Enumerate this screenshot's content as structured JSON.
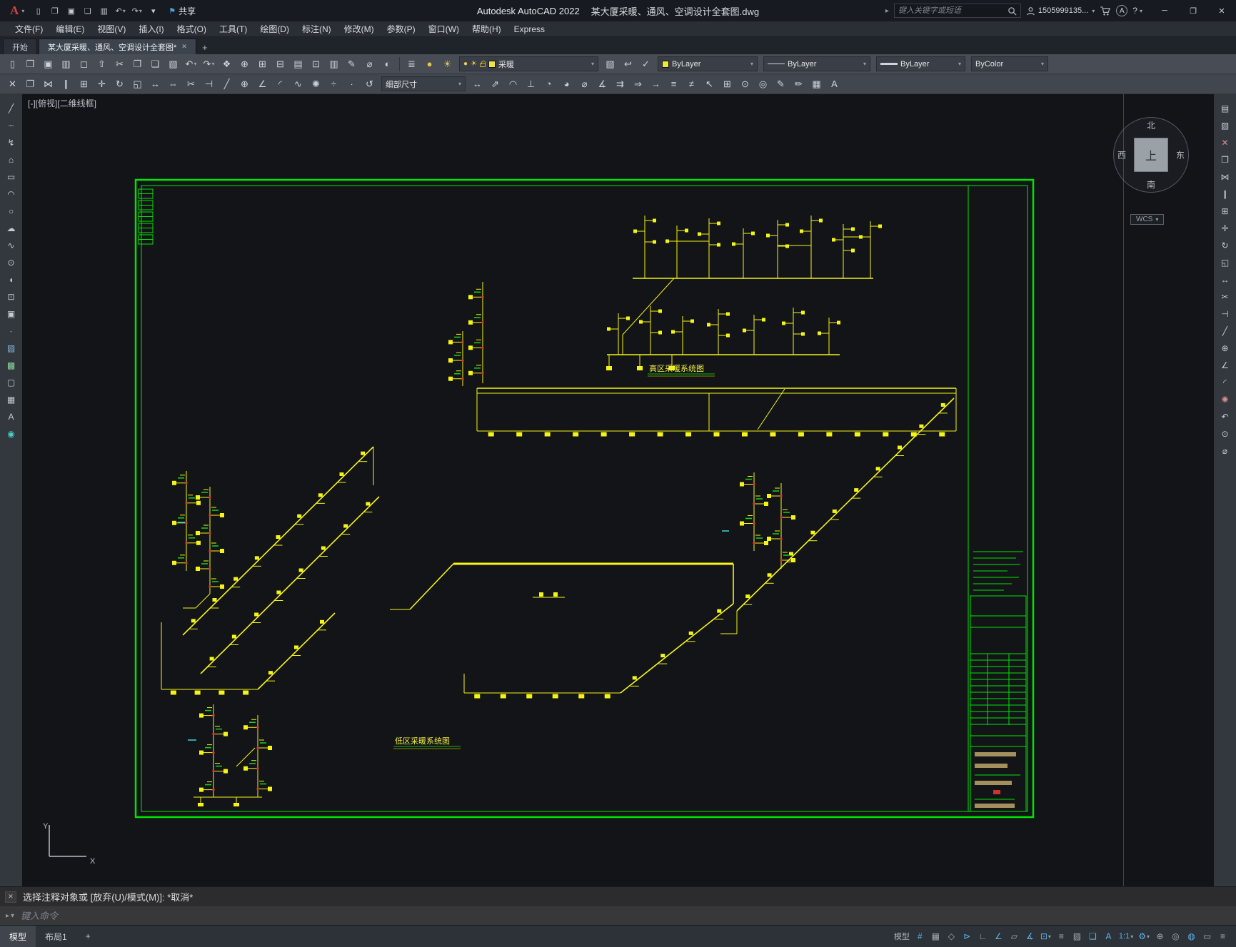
{
  "titlebar": {
    "logo_letter": "A",
    "app_title": "Autodesk AutoCAD 2022",
    "doc_title": "某大厦采暖、通风、空调设计全套图.dwg",
    "share_label": "共享",
    "search_placeholder": "键入关键字或短语",
    "user": "1505999135..."
  },
  "menu": {
    "items": [
      {
        "id": "file",
        "label": "文件(F)"
      },
      {
        "id": "edit",
        "label": "编辑(E)"
      },
      {
        "id": "view",
        "label": "视图(V)"
      },
      {
        "id": "insert",
        "label": "插入(I)"
      },
      {
        "id": "format",
        "label": "格式(O)"
      },
      {
        "id": "tools",
        "label": "工具(T)"
      },
      {
        "id": "draw",
        "label": "绘图(D)"
      },
      {
        "id": "dimension",
        "label": "标注(N)"
      },
      {
        "id": "modify",
        "label": "修改(M)"
      },
      {
        "id": "parametric",
        "label": "参数(P)"
      },
      {
        "id": "window",
        "label": "窗口(W)"
      },
      {
        "id": "help",
        "label": "帮助(H)"
      },
      {
        "id": "express",
        "label": "Express"
      }
    ]
  },
  "tabs": {
    "start": "开始",
    "drawing": "某大厦采暖、通风、空调设计全套图*"
  },
  "toolbar1": {
    "layer": "采暖",
    "color": "ByLayer",
    "linetype": "ByLayer",
    "lineweight": "ByLayer",
    "plotstyle": "ByColor"
  },
  "toolbar2": {
    "dim_style": "细部尺寸"
  },
  "canvas": {
    "viewport_label": "[-][俯视][二维线框]",
    "labels": {
      "high": "高区采暖系统图",
      "low": "低区采暖系统图"
    },
    "viewcube": {
      "n": "北",
      "s": "南",
      "w": "西",
      "e": "东",
      "top": "上",
      "wcs": "WCS"
    }
  },
  "command": {
    "history": "选择注释对象或 [放弃(U)/模式(M)]: *取消*",
    "placeholder": "键入命令"
  },
  "statusbar": {
    "model_tab": "模型",
    "layout_tab": "布局1",
    "new_layout": "+"
  },
  "colors": {
    "frame_green": "#00e400",
    "pipe_yellow": "#f4f416",
    "accent_blue": "#5fb2e8"
  },
  "icons": {
    "qa": [
      {
        "n": "new-drawing",
        "g": "▯"
      },
      {
        "n": "open-drawing",
        "g": "❒"
      },
      {
        "n": "save",
        "g": "▣"
      },
      {
        "n": "save-as",
        "g": "❏"
      },
      {
        "n": "plot",
        "g": "▥"
      },
      {
        "n": "undo",
        "g": "↶",
        "dd": 1
      },
      {
        "n": "redo",
        "g": "↷",
        "dd": 1
      },
      {
        "n": "customize-quick-access",
        "g": "▾"
      }
    ],
    "tb1": [
      {
        "n": "qnew",
        "g": "▯"
      },
      {
        "n": "open",
        "g": "❒"
      },
      {
        "n": "save-file",
        "g": "▣"
      },
      {
        "n": "plot-drawing",
        "g": "▥"
      },
      {
        "n": "plot-preview",
        "g": "◻"
      },
      {
        "n": "publish",
        "g": "⇧"
      },
      {
        "n": "cut-clip",
        "g": "✂"
      },
      {
        "n": "copy-clip",
        "g": "❐"
      },
      {
        "n": "paste-clip",
        "g": "❑"
      },
      {
        "n": "match-properties",
        "g": "▧"
      },
      {
        "n": "undo-action",
        "g": "↶",
        "dd": 1
      },
      {
        "n": "redo-action",
        "g": "↷",
        "dd": 1
      },
      {
        "n": "pan-realtime",
        "g": "❖"
      },
      {
        "n": "zoom-realtime",
        "g": "⊕"
      },
      {
        "n": "zoom-window",
        "g": "⊞"
      },
      {
        "n": "zoom-previous",
        "g": "⊟"
      },
      {
        "n": "properties-palette",
        "g": "▤"
      },
      {
        "n": "design-center",
        "g": "⊡"
      },
      {
        "n": "tool-palettes",
        "g": "▥"
      },
      {
        "n": "markup",
        "g": "✎"
      },
      {
        "n": "measure-geometry",
        "g": "⌀"
      },
      {
        "n": "render",
        "g": "◐"
      }
    ],
    "layerTools": [
      {
        "n": "layer-properties",
        "g": "≣"
      },
      {
        "n": "layer-off",
        "g": "●",
        "c": "#e9c64a"
      },
      {
        "n": "layer-isolate",
        "g": "☀",
        "c": "#e9c64a"
      }
    ],
    "layerTools2": [
      {
        "n": "layer-match",
        "g": "▧"
      },
      {
        "n": "layer-previous",
        "g": "↩"
      },
      {
        "n": "make-object-layer-current",
        "g": "✓"
      }
    ],
    "tb2a": [
      {
        "n": "erase",
        "g": "✕"
      },
      {
        "n": "copy-object",
        "g": "❐"
      },
      {
        "n": "mirror",
        "g": "⋈"
      },
      {
        "n": "offset",
        "g": "∥"
      },
      {
        "n": "array",
        "g": "⊞"
      },
      {
        "n": "move",
        "g": "✛"
      },
      {
        "n": "rotate",
        "g": "↻"
      },
      {
        "n": "scale",
        "g": "◱"
      },
      {
        "n": "stretch",
        "g": "↔"
      },
      {
        "n": "lengthen",
        "g": "⇔"
      },
      {
        "n": "trim",
        "g": "✂"
      },
      {
        "n": "extend",
        "g": "⊣"
      },
      {
        "n": "break",
        "g": "╱"
      },
      {
        "n": "join",
        "g": "⊕"
      },
      {
        "n": "chamfer",
        "g": "∠"
      },
      {
        "n": "fillet",
        "g": "◜"
      },
      {
        "n": "blend-curves",
        "g": "∿"
      },
      {
        "n": "explode",
        "g": "✺"
      },
      {
        "n": "divide",
        "g": "÷"
      },
      {
        "n": "point-style",
        "g": "∙"
      },
      {
        "n": "dimension-update",
        "g": "↺"
      }
    ],
    "tb2b": [
      {
        "n": "dim-linear",
        "g": "↔"
      },
      {
        "n": "dim-aligned",
        "g": "⇗"
      },
      {
        "n": "dim-arc-length",
        "g": "◠"
      },
      {
        "n": "dim-ordinate",
        "g": "⊥"
      },
      {
        "n": "dim-radius",
        "g": "◔"
      },
      {
        "n": "dim-jogged",
        "g": "◕"
      },
      {
        "n": "dim-diameter",
        "g": "⌀"
      },
      {
        "n": "dim-angular",
        "g": "∡"
      },
      {
        "n": "quick-dim",
        "g": "⇉"
      },
      {
        "n": "dim-baseline",
        "g": "⇒"
      },
      {
        "n": "dim-continue",
        "g": "→"
      },
      {
        "n": "dim-space",
        "g": "≡"
      },
      {
        "n": "dim-break",
        "g": "≠"
      },
      {
        "n": "multileader",
        "g": "↖"
      },
      {
        "n": "tolerance",
        "g": "⊞"
      },
      {
        "n": "center-mark",
        "g": "⊙"
      },
      {
        "n": "inspection",
        "g": "◎"
      },
      {
        "n": "dim-edit",
        "g": "✎"
      },
      {
        "n": "dim-text-edit",
        "g": "✏"
      },
      {
        "n": "insert-table",
        "g": "▦"
      },
      {
        "n": "multiline-text",
        "g": "A"
      }
    ],
    "drawbar": [
      {
        "n": "line",
        "g": "╱"
      },
      {
        "n": "construction-line",
        "g": "┈"
      },
      {
        "n": "polyline",
        "g": "↯"
      },
      {
        "n": "polygon",
        "g": "⌂"
      },
      {
        "n": "rectangle",
        "g": "▭"
      },
      {
        "n": "arc",
        "g": "◠"
      },
      {
        "n": "circle",
        "g": "○"
      },
      {
        "n": "revision-cloud",
        "g": "☁"
      },
      {
        "n": "spline",
        "g": "∿"
      },
      {
        "n": "ellipse",
        "g": "⊙"
      },
      {
        "n": "ellipse-arc",
        "g": "◖"
      },
      {
        "n": "insert-block",
        "g": "⊡"
      },
      {
        "n": "make-block",
        "g": "▣"
      },
      {
        "n": "point",
        "g": "∙"
      },
      {
        "n": "hatch",
        "g": "▨",
        "c": "#86b7de"
      },
      {
        "n": "gradient",
        "g": "▩",
        "c": "#8fd4a0"
      },
      {
        "n": "region",
        "g": "▢"
      },
      {
        "n": "table",
        "g": "▦"
      },
      {
        "n": "text",
        "g": "A"
      },
      {
        "n": "point-style-tool",
        "g": "◉",
        "c": "#45d0c2"
      }
    ],
    "modifybar": [
      {
        "n": "properties",
        "g": "▤"
      },
      {
        "n": "match-props",
        "g": "▧"
      },
      {
        "n": "erase-object",
        "g": "✕",
        "c": "#d98f8f"
      },
      {
        "n": "copy-tool",
        "g": "❐"
      },
      {
        "n": "mirror-tool",
        "g": "⋈"
      },
      {
        "n": "offset-tool",
        "g": "∥"
      },
      {
        "n": "array-tool",
        "g": "⊞"
      },
      {
        "n": "move-tool",
        "g": "✛"
      },
      {
        "n": "rotate-tool",
        "g": "↻"
      },
      {
        "n": "scale-tool",
        "g": "◱"
      },
      {
        "n": "stretch-tool",
        "g": "↔"
      },
      {
        "n": "trim-tool",
        "g": "✂"
      },
      {
        "n": "extend-tool",
        "g": "⊣"
      },
      {
        "n": "break-tool",
        "g": "╱"
      },
      {
        "n": "join-tool",
        "g": "⊕"
      },
      {
        "n": "chamfer-tool",
        "g": "∠"
      },
      {
        "n": "fillet-tool",
        "g": "◜"
      },
      {
        "n": "explode-tool",
        "g": "✺",
        "c": "#d98f8f"
      },
      {
        "n": "undo-small",
        "g": "↶"
      },
      {
        "n": "osnap-settings",
        "g": "⊙"
      },
      {
        "n": "distance",
        "g": "⌀"
      }
    ],
    "status": [
      {
        "n": "model-space-toggle",
        "g": "模型",
        "t": 1
      },
      {
        "n": "grid-display",
        "g": "#",
        "on": 1
      },
      {
        "n": "snap-mode",
        "g": "▦"
      },
      {
        "n": "infer-constraints",
        "g": "◇"
      },
      {
        "n": "dynamic-input",
        "g": "⊳",
        "on": 1
      },
      {
        "n": "ortho-mode",
        "g": "∟"
      },
      {
        "n": "polar-tracking",
        "g": "∠",
        "on": 1
      },
      {
        "n": "isometric-drafting",
        "g": "▱"
      },
      {
        "n": "osnap-tracking",
        "g": "∡",
        "on": 1
      },
      {
        "n": "object-snap",
        "g": "⊡",
        "on": 1,
        "dd": 1
      },
      {
        "n": "lineweight-display",
        "g": "≡"
      },
      {
        "n": "transparency-display",
        "g": "▨"
      },
      {
        "n": "selection-cycling",
        "g": "❏",
        "on": 1
      },
      {
        "n": "annotation-visibility",
        "g": "A",
        "on": 1
      },
      {
        "n": "annotation-scale",
        "g": "1:1",
        "t": 1,
        "on": 1,
        "dd": 1
      },
      {
        "n": "workspace-switching",
        "g": "⚙",
        "on": 1,
        "dd": 1
      },
      {
        "n": "annotation-monitor",
        "g": "⊕"
      },
      {
        "n": "isolate-objects",
        "g": "◎"
      },
      {
        "n": "graphics-performance",
        "g": "◍",
        "on": 1
      },
      {
        "n": "clean-screen",
        "g": "▭"
      },
      {
        "n": "customization",
        "g": "≡"
      }
    ]
  }
}
